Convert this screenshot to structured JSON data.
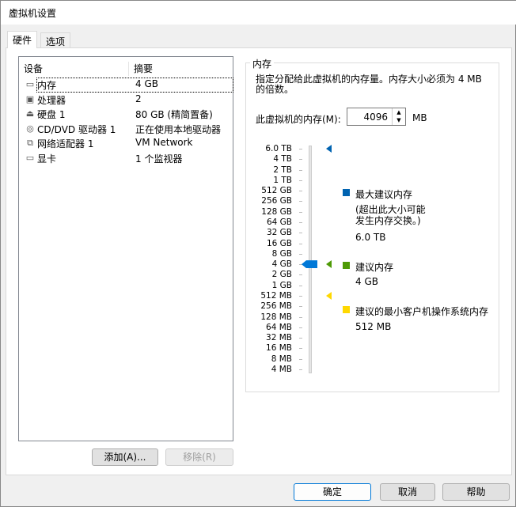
{
  "window": {
    "title": "虚拟机设置",
    "close": "✕"
  },
  "tabs": [
    {
      "label": "硬件"
    },
    {
      "label": "选项"
    }
  ],
  "list": {
    "col_device": "设备",
    "col_summary": "摘要",
    "items": [
      {
        "name": "内存",
        "summary": "4 GB",
        "icon": "memory-icon"
      },
      {
        "name": "处理器",
        "summary": "2",
        "icon": "cpu-icon"
      },
      {
        "name": "硬盘 1",
        "summary": "80 GB (精简置备)",
        "icon": "harddisk-icon"
      },
      {
        "name": "CD/DVD 驱动器 1",
        "summary": "正在使用本地驱动器",
        "icon": "cd-icon"
      },
      {
        "name": "网络适配器 1",
        "summary": "VM Network",
        "icon": "network-icon"
      },
      {
        "name": "显卡",
        "summary": "1 个监视器",
        "icon": "monitor-icon"
      }
    ]
  },
  "buttons": {
    "add": "添加(A)...",
    "remove": "移除(R)",
    "ok": "确定",
    "cancel": "取消",
    "help": "帮助"
  },
  "memory": {
    "group_title": "内存",
    "desc": "指定分配给此虚拟机的内存量。内存大小必须为 4 MB 的倍数。",
    "field_label": "此虚拟机的内存(M):",
    "value": "4096",
    "unit": "MB",
    "ticks": [
      "6.0 TB",
      "4 TB",
      "2 TB",
      "1 TB",
      "512 GB",
      "256 GB",
      "128 GB",
      "64 GB",
      "32 GB",
      "16 GB",
      "8 GB",
      "4 GB",
      "2 GB",
      "1 GB",
      "512 MB",
      "256 MB",
      "128 MB",
      "64 MB",
      "32 MB",
      "16 MB",
      "8 MB",
      "4 MB"
    ],
    "slider_index": 11,
    "max_label": "最大建议内存",
    "max_note": "(超出此大小可能发生内存交换。)",
    "max_value": "6.0 TB",
    "max_index": 0,
    "max_color": "#0063b1",
    "rec_label": "建议内存",
    "rec_value": "4 GB",
    "rec_index": 11,
    "rec_color": "#4e9a06",
    "min_label": "建议的最小客户机操作系统内存",
    "min_value": "512 MB",
    "min_index": 14,
    "min_color": "#ffd800"
  }
}
